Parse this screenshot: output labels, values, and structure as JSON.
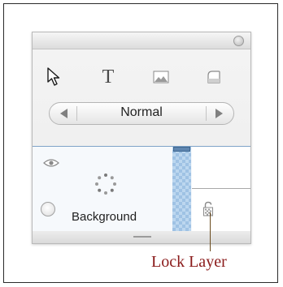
{
  "panel": {
    "tools": [
      {
        "name": "select-tool",
        "icon": "arrow-pointer-icon"
      },
      {
        "name": "text-tool",
        "icon": "text-t-icon",
        "glyph": "T"
      },
      {
        "name": "image-tool",
        "icon": "picture-icon"
      },
      {
        "name": "shape-tool",
        "icon": "rounded-shape-icon"
      }
    ],
    "blend_mode": {
      "value": "Normal",
      "prev_icon": "left-arrow-icon",
      "next_icon": "right-arrow-icon"
    },
    "layer": {
      "name": "Background",
      "visibility_icon": "eye-icon",
      "lock_icon": "padlock-icon"
    }
  },
  "annotation": {
    "label": "Lock Layer",
    "color": "#8a1a1a"
  }
}
